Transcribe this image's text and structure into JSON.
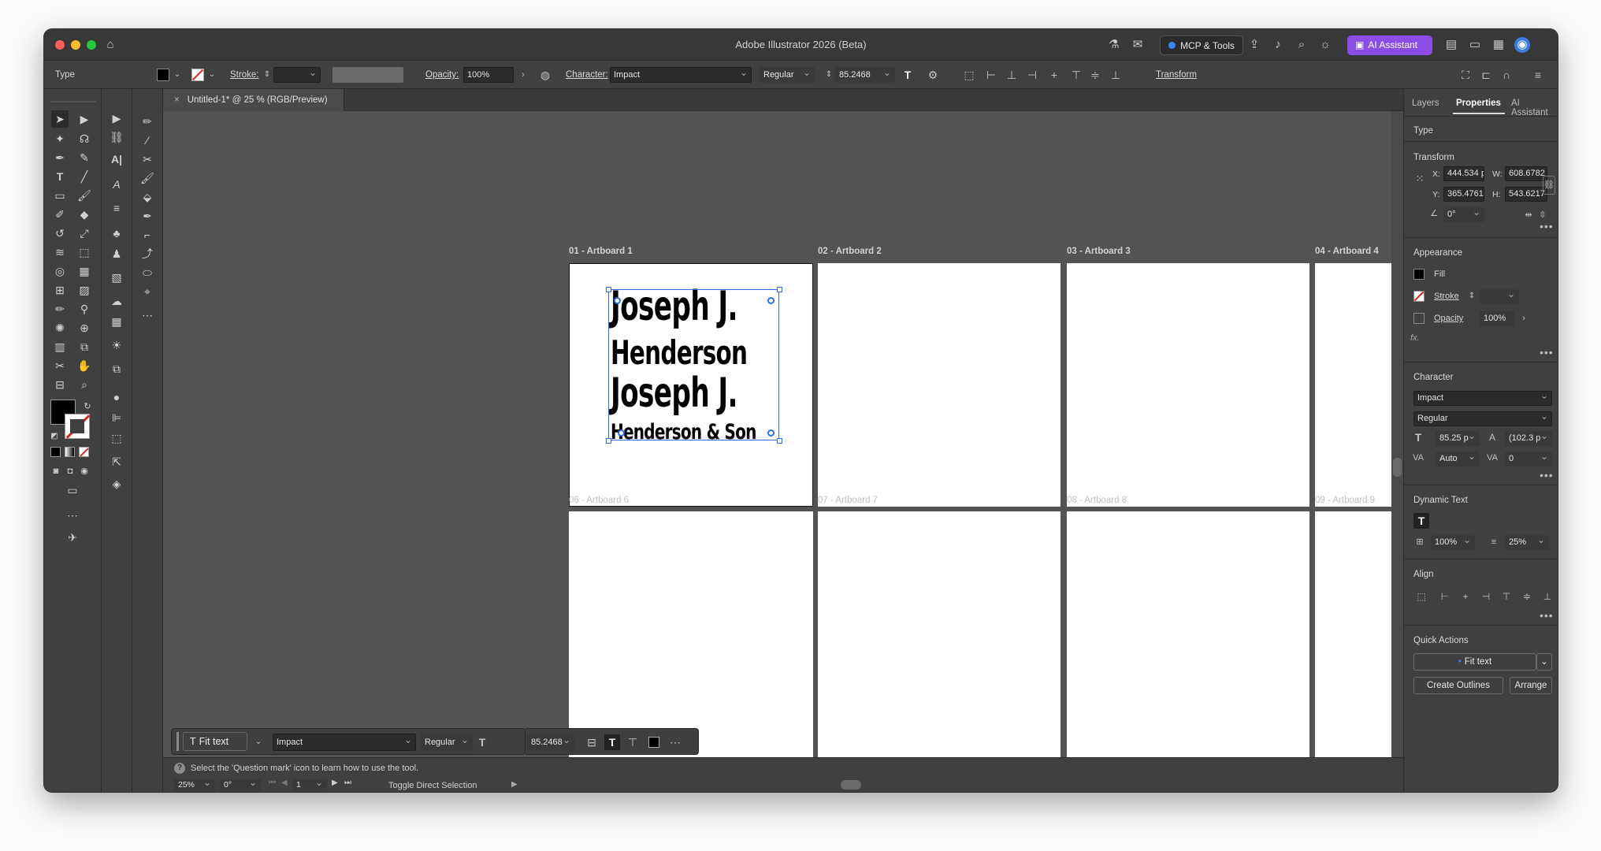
{
  "window": {
    "title": "Adobe Illustrator 2026 (Beta)",
    "mcp_label": "MCP & Tools",
    "ai_label": "AI Assistant"
  },
  "control": {
    "mode": "Type",
    "stroke_label": "Stroke:",
    "opacity_label": "Opacity:",
    "opacity_value": "100%",
    "character_label": "Character:",
    "font": "Impact",
    "style": "Regular",
    "size": "85.2468",
    "transform_label": "Transform"
  },
  "document": {
    "tab_label": "Untitled-1* @ 25 % (RGB/Preview)"
  },
  "artboards": [
    {
      "label": "01 - Artboard 1"
    },
    {
      "label": "02 - Artboard 2"
    },
    {
      "label": "03 - Artboard 3"
    },
    {
      "label": "04 - Artboard 4"
    },
    {
      "label": "06 - Artboard 6"
    },
    {
      "label": "07 - Artboard 7"
    },
    {
      "label": "08 - Artboard 8"
    },
    {
      "label": "09 - Artboard 9"
    }
  ],
  "text_lines": [
    "Joseph J.",
    "Henderson",
    "Joseph J.",
    "Henderson & Son"
  ],
  "contextual": {
    "fit_text": "Fit text",
    "font": "Impact",
    "style": "Regular",
    "size": "85.2468"
  },
  "status": {
    "hint": "Select the 'Question mark' icon to learn how to use the tool.",
    "zoom": "25%",
    "rotation": "0°",
    "artboard_num": "1",
    "tool_status": "Toggle Direct Selection"
  },
  "panel": {
    "tabs": [
      "Layers",
      "Properties",
      "AI Assistant"
    ],
    "type_heading": "Type",
    "transform": {
      "heading": "Transform",
      "x_label": "X:",
      "x": "444.534 p",
      "y_label": "Y:",
      "y": "365.4761",
      "w_label": "W:",
      "w": "608.6782",
      "h_label": "H:",
      "h": "543.6217",
      "angle": "0°"
    },
    "appearance": {
      "heading": "Appearance",
      "fill": "Fill",
      "stroke": "Stroke",
      "opacity": "Opacity",
      "opacity_value": "100%",
      "fx": "fx."
    },
    "character": {
      "heading": "Character",
      "font": "Impact",
      "style": "Regular",
      "size": "85.25 p",
      "leading": "(102.3 p",
      "kerning": "Auto",
      "tracking": "0"
    },
    "dynamic_text": {
      "heading": "Dynamic Text",
      "value1": "100%",
      "value2": "25%"
    },
    "align_heading": "Align",
    "quick_actions": {
      "heading": "Quick Actions",
      "fit_text": "Fit text",
      "create_outlines": "Create Outlines",
      "arrange": "Arrange"
    }
  },
  "colors": {
    "accent": "#2f6fde",
    "ai_button": "#8b4de6",
    "canvas": "#535353",
    "panel": "#404040"
  }
}
